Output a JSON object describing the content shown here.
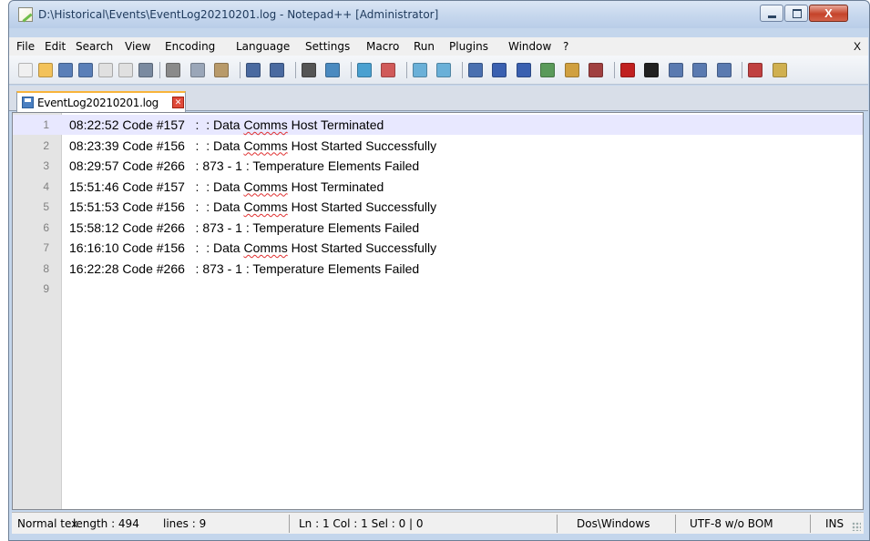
{
  "window": {
    "title": "D:\\Historical\\Events\\EventLog20210201.log - Notepad++ [Administrator]",
    "close_glyph": "X"
  },
  "menubar": {
    "items": [
      "File",
      "Edit",
      "Search",
      "View",
      "Encoding",
      "Language",
      "Settings",
      "Macro",
      "Run",
      "Plugins",
      "Window",
      "?"
    ],
    "close_glyph": "X"
  },
  "toolbar": {
    "icons": [
      "new-file-icon",
      "open-file-icon",
      "save-icon",
      "save-all-icon",
      "close-icon",
      "close-all-icon",
      "print-icon",
      "cut-icon",
      "copy-icon",
      "paste-icon",
      "undo-icon",
      "redo-icon",
      "find-icon",
      "replace-icon",
      "zoom-in-icon",
      "zoom-out-icon",
      "sync-vertical-icon",
      "sync-horizontal-icon",
      "word-wrap-icon",
      "show-all-chars-icon",
      "indent-guide-icon",
      "doc-map-icon",
      "function-list-icon",
      "folder-workspace-icon",
      "record-macro-icon",
      "stop-macro-icon",
      "play-macro-icon",
      "run-macro-multiple-icon",
      "save-macro-icon",
      "spellcheck-icon",
      "extra-icon"
    ]
  },
  "tab": {
    "label": "EventLog20210201.log",
    "close_glyph": "✕"
  },
  "editor": {
    "current_line": 1,
    "lines": [
      {
        "num": "1",
        "pre": "08:22:52 Code #157   :  : Data ",
        "misspelled": "Comms",
        "post": " Host Terminated"
      },
      {
        "num": "2",
        "pre": "08:23:39 Code #156   :  : Data ",
        "misspelled": "Comms",
        "post": " Host Started Successfully"
      },
      {
        "num": "3",
        "pre": "08:29:57 Code #266   : 873 - 1 : Temperature Elements Failed",
        "misspelled": "",
        "post": ""
      },
      {
        "num": "4",
        "pre": "15:51:46 Code #157   :  : Data ",
        "misspelled": "Comms",
        "post": " Host Terminated"
      },
      {
        "num": "5",
        "pre": "15:51:53 Code #156   :  : Data ",
        "misspelled": "Comms",
        "post": " Host Started Successfully"
      },
      {
        "num": "6",
        "pre": "15:58:12 Code #266   : 873 - 1 : Temperature Elements Failed",
        "misspelled": "",
        "post": ""
      },
      {
        "num": "7",
        "pre": "16:16:10 Code #156   :  : Data ",
        "misspelled": "Comms",
        "post": " Host Started Successfully"
      },
      {
        "num": "8",
        "pre": "16:22:28 Code #266   : 873 - 1 : Temperature Elements Failed",
        "misspelled": "",
        "post": ""
      },
      {
        "num": "9",
        "pre": "",
        "misspelled": "",
        "post": ""
      }
    ]
  },
  "statusbar": {
    "filetype": "Normal tex",
    "length": "length : 494",
    "lines": "lines : 9",
    "position": "Ln : 1    Col : 1    Sel : 0 | 0",
    "eol": "Dos\\Windows",
    "encoding": "UTF-8 w/o BOM",
    "mode": "INS"
  }
}
